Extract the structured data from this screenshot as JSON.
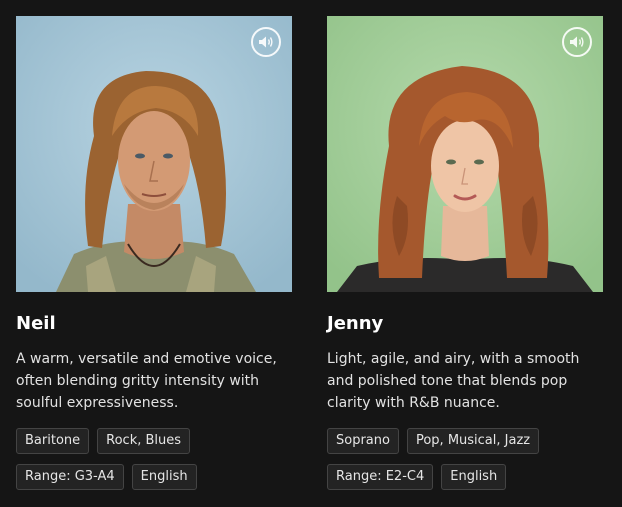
{
  "voices": [
    {
      "name": "Neil",
      "description": "A warm, versatile and emotive voice, often blending gritty intensity with soulful expressiveness.",
      "tags": [
        "Baritone",
        "Rock, Blues",
        "Range: G3-A4",
        "English"
      ],
      "background_color": "#a9c8d8",
      "sound_icon": "speaker-volume-icon"
    },
    {
      "name": "Jenny",
      "description": "Light, agile, and airy, with a smooth and polished tone that blends pop clarity with R&B nuance.",
      "tags": [
        "Soprano",
        "Pop, Musical, Jazz",
        "Range: E2-C4",
        "English"
      ],
      "background_color": "#a8cfa0",
      "sound_icon": "speaker-volume-icon"
    }
  ],
  "colors": {
    "page_background": "#151515",
    "tag_background": "#232323",
    "tag_border": "#444444"
  }
}
